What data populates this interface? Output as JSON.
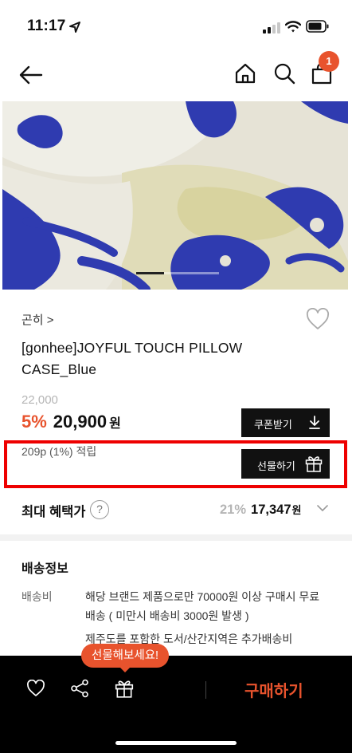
{
  "status_bar": {
    "time": "11:17"
  },
  "nav": {
    "cart_count": "1"
  },
  "product": {
    "breadcrumb": "곤히 >",
    "title": "[gonhee]JOYFUL TOUCH PILLOW CASE_Blue",
    "original_price": "22,000",
    "discount_pct": "5%",
    "sale_price": "20,900",
    "currency": "원",
    "points": "209p (1%) 적립",
    "image_pager": {
      "total": 3,
      "current": 1
    }
  },
  "buttons": {
    "coupon": "쿠폰받기",
    "gift": "선물하기",
    "buy": "구매하기"
  },
  "benefit": {
    "label": "최대 혜택가",
    "help": "?",
    "pct": "21%",
    "price": "17,347",
    "currency": "원"
  },
  "shipping": {
    "title": "배송정보",
    "fee_label": "배송비",
    "fee_text": "해당 브랜드 제품으로만 70000원 이상 구매시 무료배송 ( 미만시 배송비 3000원 발생 )",
    "extra_text": "제주도를 포함한 도서/산간지역은 추가배송비"
  },
  "tooltip": {
    "text": "선물해보세요!"
  },
  "colors": {
    "accent": "#e8532d",
    "dark": "#111111",
    "highlight_border": "#ee0000",
    "muted": "#b5b5b5"
  },
  "icons": {
    "back": "arrow-left-icon",
    "home": "home-icon",
    "search": "search-icon",
    "cart": "shopping-bag-icon",
    "wishlist": "heart-icon",
    "download": "download-icon",
    "gift": "gift-icon",
    "share": "share-icon",
    "chevron": "chevron-down-icon"
  }
}
